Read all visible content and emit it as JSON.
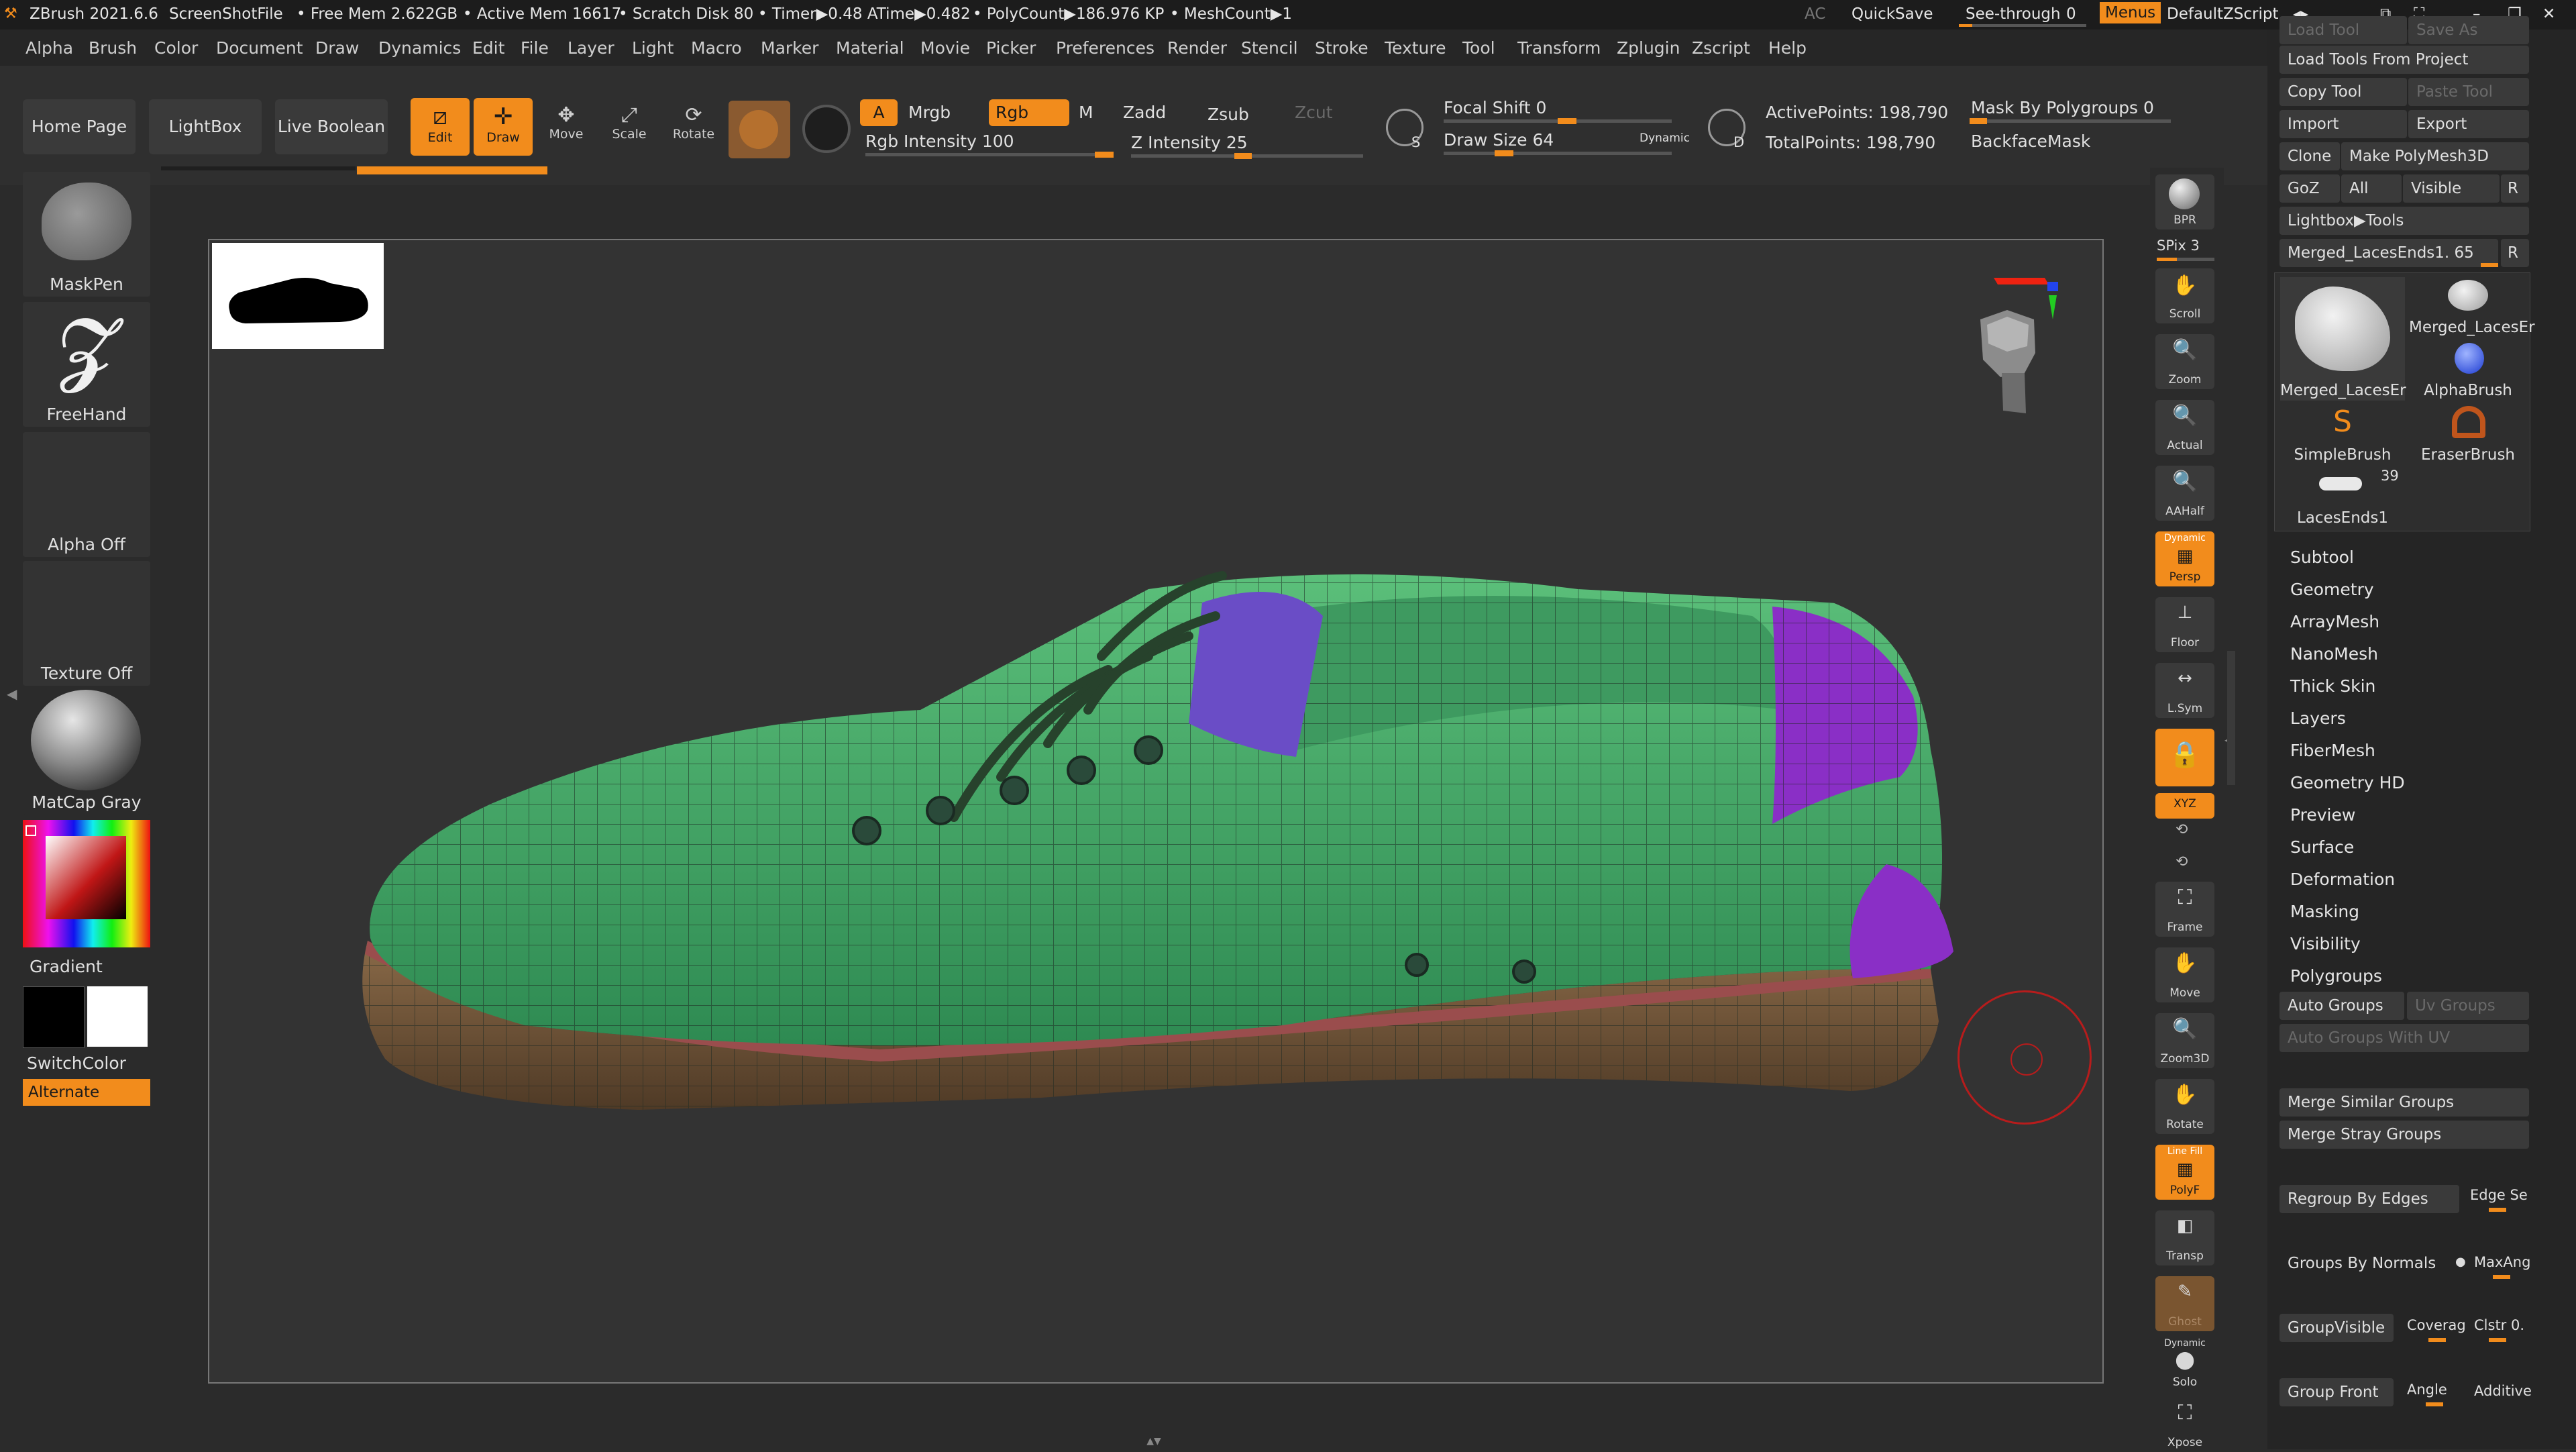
{
  "titlebar": {
    "app": "ZBrush 2021.6.6",
    "screenshot": "ScreenShotFile",
    "free_mem": "• Free Mem 2.622GB",
    "active_mem": "• Active Mem 16617",
    "scratch": "• Scratch Disk 80",
    "timer": "• Timer▶0.48 ATime▶0.482",
    "polycount": "• PolyCount▶186.976 KP",
    "meshcount": "• MeshCount▶1",
    "ac": "AC",
    "quicksave": "QuickSave",
    "seethrough": "See-through",
    "seethrough_val": "0",
    "menus": "Menus",
    "zscript": "DefaultZScript"
  },
  "menubar": [
    "Alpha",
    "Brush",
    "Color",
    "Document",
    "Draw",
    "Dynamics",
    "Edit",
    "File",
    "Layer",
    "Light",
    "Macro",
    "Marker",
    "Material",
    "Movie",
    "Picker",
    "Preferences",
    "Render",
    "Stencil",
    "Stroke",
    "Texture",
    "Tool",
    "Transform",
    "Zplugin",
    "Zscript",
    "Help"
  ],
  "toolbar": {
    "home": "Home Page",
    "lightbox": "LightBox",
    "liveboolean": "Live Boolean",
    "edit": "Edit",
    "draw": "Draw",
    "move": "Move",
    "scale": "Scale",
    "rotate": "Rotate",
    "a": "A",
    "mrgb": "Mrgb",
    "rgb": "Rgb",
    "m": "M",
    "zadd": "Zadd",
    "zsub": "Zsub",
    "zcut": "Zcut",
    "rgb_intensity": "Rgb Intensity 100",
    "z_intensity": "Z Intensity 25",
    "focal_shift": "Focal Shift 0",
    "draw_size": "Draw Size 64",
    "dynamic": "Dynamic",
    "active_points": "ActivePoints: 198,790",
    "total_points": "TotalPoints: 198,790",
    "mask_polygroups": "Mask By Polygroups 0",
    "backface": "BackfaceMask",
    "s_label": "S",
    "d_label": "D"
  },
  "leftshelf": {
    "brush": "MaskPen",
    "stroke": "FreeHand",
    "alpha": "Alpha Off",
    "texture": "Texture Off",
    "material": "MatCap Gray",
    "gradient": "Gradient",
    "switchcolor": "SwitchColor",
    "alternate": "Alternate"
  },
  "rightshelf": {
    "bpr": "BPR",
    "spix": "SPix 3",
    "scroll": "Scroll",
    "zoom": "Zoom",
    "actual": "Actual",
    "aahalf": "AAHalf",
    "persp_top": "Dynamic",
    "persp": "Persp",
    "floor": "Floor",
    "lsym": "L.Sym",
    "xyz": "XYZ",
    "frame": "Frame",
    "move": "Move",
    "zoom3d": "Zoom3D",
    "rotate": "Rotate",
    "polyf_top": "Line Fill",
    "polyf": "PolyF",
    "transp": "Transp",
    "ghost": "Ghost",
    "solo_top": "Dynamic",
    "solo": "Solo",
    "xpose": "Xpose"
  },
  "toolpalette": {
    "load_tool": "Load Tool",
    "save_as": "Save As",
    "load_project": "Load Tools From Project",
    "copy_tool": "Copy Tool",
    "paste_tool": "Paste Tool",
    "import": "Import",
    "export": "Export",
    "clone": "Clone",
    "make_polymesh": "Make PolyMesh3D",
    "goz": "GoZ",
    "all": "All",
    "visible": "Visible",
    "r": "R",
    "lightbox_tools": "Lightbox▶Tools",
    "current_tool": "Merged_LacesEnds1. 65",
    "thumbs": [
      {
        "label": "Merged_LacesEr"
      },
      {
        "label": "Merged_LacesEr"
      },
      {
        "label": "AlphaBrush"
      },
      {
        "label": "SimpleBrush"
      },
      {
        "label": "EraserBrush"
      },
      {
        "label": "LacesEnds1"
      }
    ],
    "laces_count": "39",
    "sections": [
      "Subtool",
      "Geometry",
      "ArrayMesh",
      "NanoMesh",
      "Thick Skin",
      "Layers",
      "FiberMesh",
      "Geometry HD",
      "Preview",
      "Surface",
      "Deformation",
      "Masking",
      "Visibility",
      "Polygroups"
    ],
    "auto_groups": "Auto Groups",
    "uv_groups": "Uv Groups",
    "auto_groups_uv": "Auto Groups With UV",
    "merge_similar": "Merge Similar Groups",
    "merge_stray": "Merge Stray Groups",
    "regroup_edges": "Regroup By Edges",
    "edge_se": "Edge Se",
    "groups_normals": "Groups By Normals",
    "maxang": "MaxAng",
    "group_visible": "GroupVisible",
    "coverage": "Coverag",
    "clstr": "Clstr 0.",
    "group_front": "Group Front",
    "angle": "Angle",
    "additive": "Additive"
  }
}
